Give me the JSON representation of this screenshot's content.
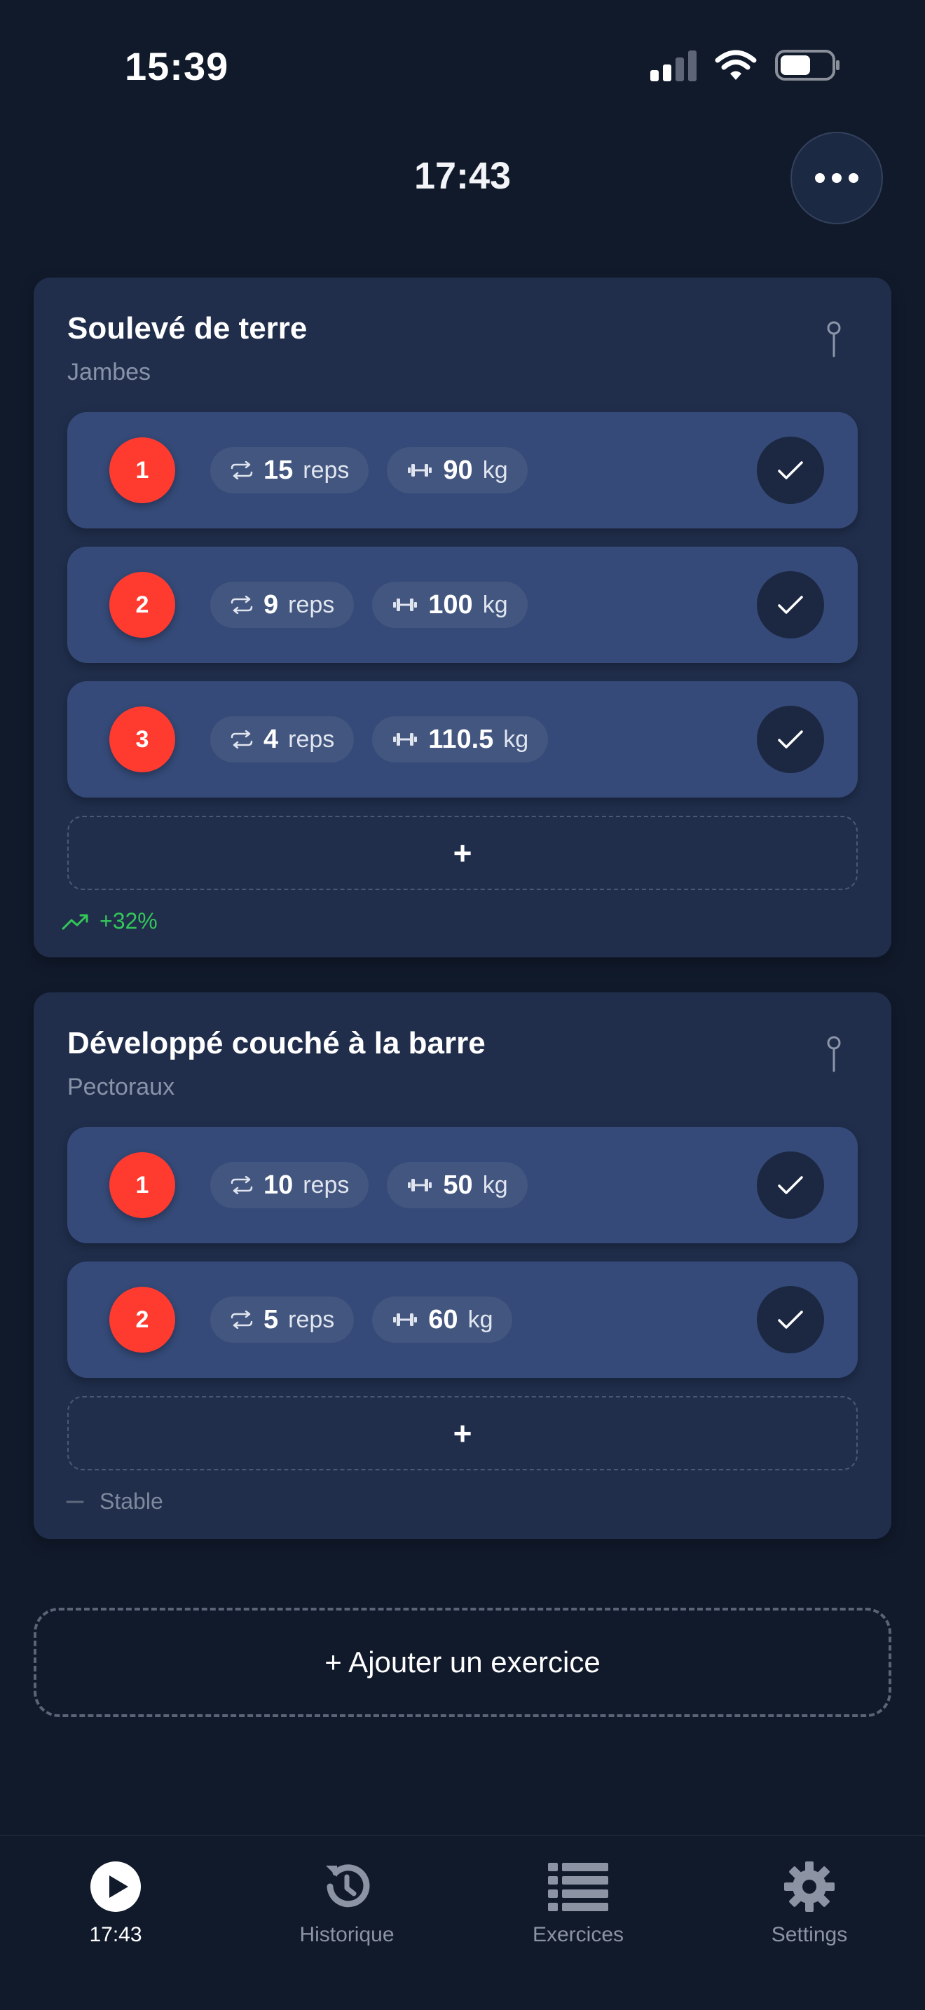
{
  "status_bar": {
    "time": "15:39"
  },
  "header": {
    "timer": "17:43"
  },
  "exercises": [
    {
      "name": "Soulevé de terre",
      "muscle_group": "Jambes",
      "sets": [
        {
          "number": "1",
          "reps": "15",
          "reps_unit": "reps",
          "weight": "90",
          "weight_unit": "kg"
        },
        {
          "number": "2",
          "reps": "9",
          "reps_unit": "reps",
          "weight": "100",
          "weight_unit": "kg"
        },
        {
          "number": "3",
          "reps": "4",
          "reps_unit": "reps",
          "weight": "110.5",
          "weight_unit": "kg"
        }
      ],
      "add_set_label": "+",
      "trend": "+32%"
    },
    {
      "name": "Développé couché à la barre",
      "muscle_group": "Pectoraux",
      "sets": [
        {
          "number": "1",
          "reps": "10",
          "reps_unit": "reps",
          "weight": "50",
          "weight_unit": "kg"
        },
        {
          "number": "2",
          "reps": "5",
          "reps_unit": "reps",
          "weight": "60",
          "weight_unit": "kg"
        }
      ],
      "add_set_label": "+",
      "trend": "Stable"
    }
  ],
  "add_exercise_label": "+ Ajouter un exercice",
  "tabs": [
    {
      "label": "17:43",
      "icon": "play-circle-icon"
    },
    {
      "label": "Historique",
      "icon": "history-icon"
    },
    {
      "label": "Exercices",
      "icon": "list-icon"
    },
    {
      "label": "Settings",
      "icon": "gear-icon"
    }
  ],
  "colors": {
    "background": "#111a2b",
    "card": "#202e4c",
    "set_row": "#354a78",
    "accent_red": "#ff3b30",
    "trend_green": "#34c759"
  }
}
